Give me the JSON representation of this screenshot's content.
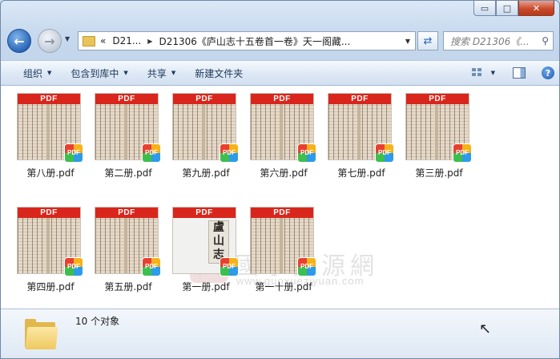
{
  "window": {
    "minimize": "▭",
    "maximize": "□",
    "close": "✕"
  },
  "nav": {
    "back_icon": "arrow-left",
    "forward_icon": "arrow-right"
  },
  "address": {
    "prefix": "«",
    "crumb1": "D21...",
    "crumb2": "D21306《庐山志十五卷首一卷》天一阁藏..."
  },
  "search": {
    "placeholder": "搜索 D21306《..."
  },
  "toolbar": {
    "organize": "组织",
    "include_library": "包含到库中",
    "share": "共享",
    "new_folder": "新建文件夹"
  },
  "files": [
    {
      "name": "第八册.pdf",
      "badge": "PDF"
    },
    {
      "name": "第二册.pdf",
      "badge": "PDF"
    },
    {
      "name": "第九册.pdf",
      "badge": "PDF"
    },
    {
      "name": "第六册.pdf",
      "badge": "PDF"
    },
    {
      "name": "第七册.pdf",
      "badge": "PDF"
    },
    {
      "name": "第三册.pdf",
      "badge": "PDF"
    },
    {
      "name": "第四册.pdf",
      "badge": "PDF"
    },
    {
      "name": "第五册.pdf",
      "badge": "PDF"
    },
    {
      "name": "第一册.pdf",
      "badge": "PDF",
      "cover_title": "盧山志"
    },
    {
      "name": "第一十册.pdf",
      "badge": "PDF"
    }
  ],
  "watermark": {
    "logo": "國",
    "chinese": "國學資源網",
    "url": "www.guoxueziyuan.com"
  },
  "status": {
    "count": "10 个对象"
  }
}
